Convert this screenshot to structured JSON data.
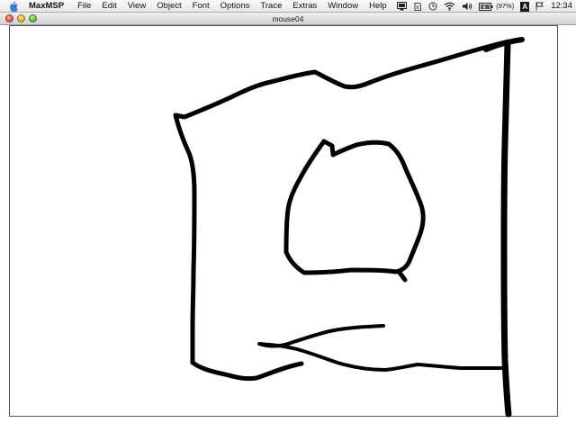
{
  "menubar": {
    "app_name": "MaxMSP",
    "items": [
      "File",
      "Edit",
      "View",
      "Object",
      "Font",
      "Options",
      "Trace",
      "Extras",
      "Window",
      "Help"
    ],
    "battery_percent": "(97%)",
    "input_menu": "A",
    "clock": "12:34"
  },
  "window": {
    "title": "mouse04"
  },
  "canvas": {
    "background": "#ffffff",
    "stroke_color": "#000000"
  }
}
